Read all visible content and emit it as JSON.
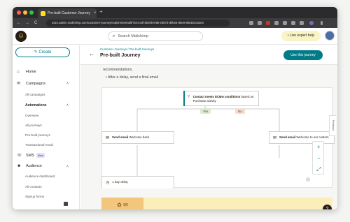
{
  "browser": {
    "tab_title": "Pre-built Customer Journey",
    "tab_close": "×",
    "new_tab": "+",
    "url": "us21.admin.mailchimp.com/customer-journey/explore/prebuilt/?id=ecd74be9b7e5b-e3b75-d0be5-d6e6-9b61bc0a4e3",
    "nav": {
      "back": "←",
      "forward": "→",
      "reload": "C"
    },
    "traffic_colors": [
      "#ff5f57",
      "#febc2e",
      "#28c840"
    ]
  },
  "header": {
    "search_placeholder": "Search Mailchimp",
    "live_help": "• Live expert help"
  },
  "sidebar": {
    "create_label": "Create",
    "home": "Home",
    "campaigns": "Campaigns",
    "campaigns_items": [
      "All campaigns"
    ],
    "automations": "Automations",
    "automation_items": [
      "Overview",
      "All journeys",
      "Pre-built journeys",
      "Transactional email"
    ],
    "sms": "SMS",
    "sms_badge": "New",
    "audience": "Audience",
    "audience_items": [
      "Audience dashboard",
      "All contacts",
      "Signup forms"
    ]
  },
  "main": {
    "breadcrumb": "Customer Journeys / Pre-built Journeys",
    "title": "Pre-built Journey",
    "use_button": "Use this journey",
    "desc_line1": "recommendations.",
    "desc_line2": "• After a delay, send a final email"
  },
  "canvas": {
    "condition_bold": "Contact meets ECBw conditions",
    "condition_rest": "based on",
    "condition_line2": "Purchase activity",
    "yes_label": "Yes",
    "no_label": "No",
    "send_left_bold": "Send email",
    "send_left_rest": "Welcome back",
    "send_right_bold": "Send email",
    "send_right_rest": "Welcome to our custom",
    "delay_label": "1 day delay",
    "zoom_in": "+",
    "zoom_out": "−",
    "fit": "⤢",
    "side_label": "Feedback"
  },
  "footer": {
    "help": "?"
  },
  "colors": {
    "accent": "#007c89",
    "yes_bg": "#dbecc9",
    "no_bg": "#f9d8cf"
  }
}
